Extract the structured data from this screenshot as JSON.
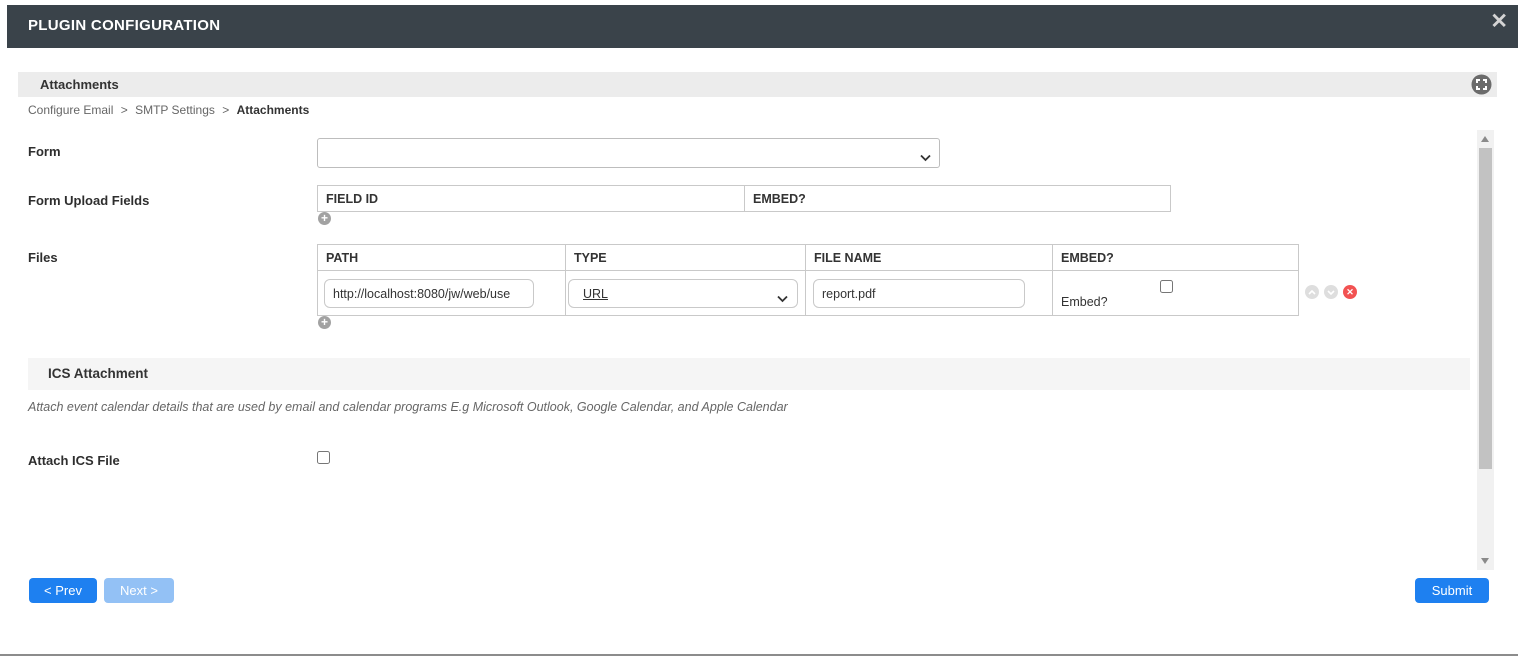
{
  "modal": {
    "title": "PLUGIN CONFIGURATION"
  },
  "icons": {
    "close": "✕",
    "add": "+",
    "delete": "✕"
  },
  "section": {
    "title": "Attachments",
    "breadcrumb": {
      "crumb1": "Configure Email",
      "sep": ">",
      "crumb2": "SMTP Settings",
      "current": "Attachments"
    }
  },
  "fields": {
    "form": {
      "label": "Form",
      "selected_value": ""
    },
    "form_upload_fields": {
      "label": "Form Upload Fields",
      "columns": [
        "FIELD ID",
        "EMBED?"
      ]
    },
    "files": {
      "label": "Files",
      "columns": [
        "PATH",
        "TYPE",
        "FILE NAME",
        "EMBED?"
      ],
      "row": {
        "path": "http://localhost:8080/jw/web/use",
        "type": "URL",
        "file_name": "report.pdf",
        "embed_label": "Embed?",
        "embed_checked": false
      }
    },
    "ics": {
      "section_title": "ICS Attachment",
      "description": "Attach event calendar details that are used by email and calendar programs E.g Microsoft Outlook, Google Calendar, and Apple Calendar",
      "attach_label": "Attach ICS File",
      "attach_checked": false
    }
  },
  "footer": {
    "prev_label": "< Prev",
    "next_label": "Next >",
    "submit_label": "Submit"
  },
  "colors": {
    "header_bg": "#3a434a",
    "accent_blue": "#1e80f0",
    "disabled_blue": "#93c1f5",
    "danger_red": "#f25252"
  }
}
